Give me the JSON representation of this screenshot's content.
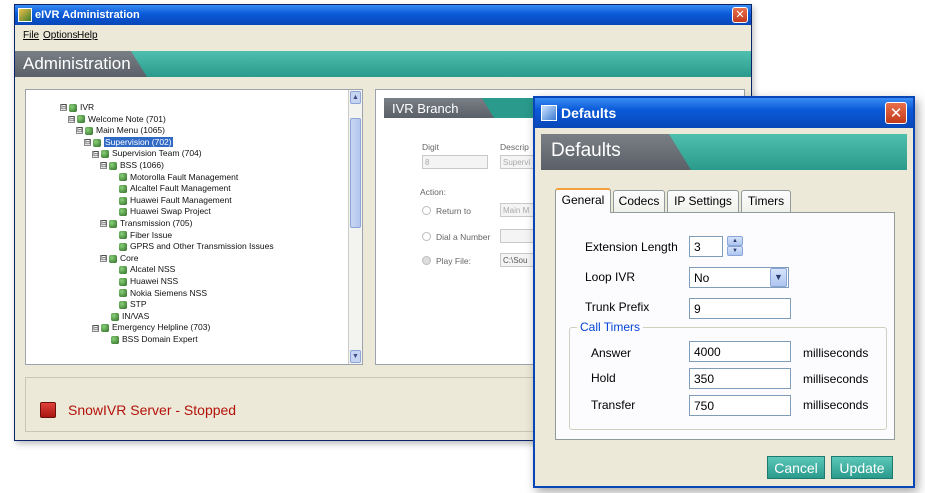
{
  "main_window": {
    "title": "eIVR Administration",
    "close_glyph": "✕",
    "menu": [
      "File",
      "Options",
      "Help"
    ],
    "section_title": "Administration"
  },
  "tree": {
    "items": [
      {
        "label": "IVR",
        "level": 0,
        "expander": "⊟"
      },
      {
        "label": "Welcome Note (701)",
        "level": 1,
        "expander": "⊟"
      },
      {
        "label": "Main Menu (1065)",
        "level": 2,
        "expander": "⊟"
      },
      {
        "label": "Supervision (702)",
        "level": 3,
        "expander": "⊟",
        "selected": true
      },
      {
        "label": "Supervision Team (704)",
        "level": 4,
        "expander": "⊟"
      },
      {
        "label": "BSS (1066)",
        "level": 5,
        "expander": "⊟"
      },
      {
        "label": "Motorolla Fault Management",
        "level": 6,
        "expander": ""
      },
      {
        "label": "Alcaltel Fault Management",
        "level": 6,
        "expander": ""
      },
      {
        "label": "Huawei Fault Management",
        "level": 6,
        "expander": ""
      },
      {
        "label": "Huawei Swap Project",
        "level": 6,
        "expander": ""
      },
      {
        "label": "Transmission (705)",
        "level": 5,
        "expander": "⊟"
      },
      {
        "label": "Fiber Issue",
        "level": 6,
        "expander": ""
      },
      {
        "label": "GPRS and Other Transmission Issues",
        "level": 6,
        "expander": ""
      },
      {
        "label": "Core",
        "level": 5,
        "expander": "⊟"
      },
      {
        "label": "Alcatel NSS",
        "level": 6,
        "expander": ""
      },
      {
        "label": "Huawei NSS",
        "level": 6,
        "expander": ""
      },
      {
        "label": "Nokia Siemens NSS",
        "level": 6,
        "expander": ""
      },
      {
        "label": "STP",
        "level": 6,
        "expander": ""
      },
      {
        "label": "IN/VAS",
        "level": 5,
        "expander": ""
      },
      {
        "label": "Emergency Helpline (703)",
        "level": 4,
        "expander": "⊟"
      },
      {
        "label": "BSS Domain Expert",
        "level": 5,
        "expander": ""
      }
    ],
    "scroll_up": "▲",
    "scroll_down": "▼"
  },
  "branch": {
    "title": "IVR Branch",
    "digit_label": "Digit",
    "digit_value": "8",
    "description_label": "Descrip",
    "description_value": "Supervi",
    "action_label": "Action:",
    "return_label": "Return to",
    "return_value": "Main M",
    "dial_label": "Dial a Number",
    "play_label": "Play File:",
    "play_value": "C:\\Sou"
  },
  "status": {
    "text": "SnowIVR Server - Stopped"
  },
  "defaults": {
    "window_title": "Defaults",
    "close_glyph": "✕",
    "section_title": "Defaults",
    "tabs": [
      "General",
      "Codecs",
      "IP Settings",
      "Timers"
    ],
    "active_tab": "General",
    "extension_length_label": "Extension Length",
    "extension_length_value": "3",
    "loop_ivr_label": "Loop IVR",
    "loop_ivr_value": "No",
    "trunk_prefix_label": "Trunk Prefix",
    "trunk_prefix_value": "9",
    "call_timers_label": "Call Timers",
    "timers": [
      {
        "label": "Answer",
        "value": "4000",
        "unit": "milliseconds"
      },
      {
        "label": "Hold",
        "value": "350",
        "unit": "milliseconds"
      },
      {
        "label": "Transfer",
        "value": "750",
        "unit": "milliseconds"
      }
    ],
    "cancel_label": "Cancel",
    "update_label": "Update"
  }
}
